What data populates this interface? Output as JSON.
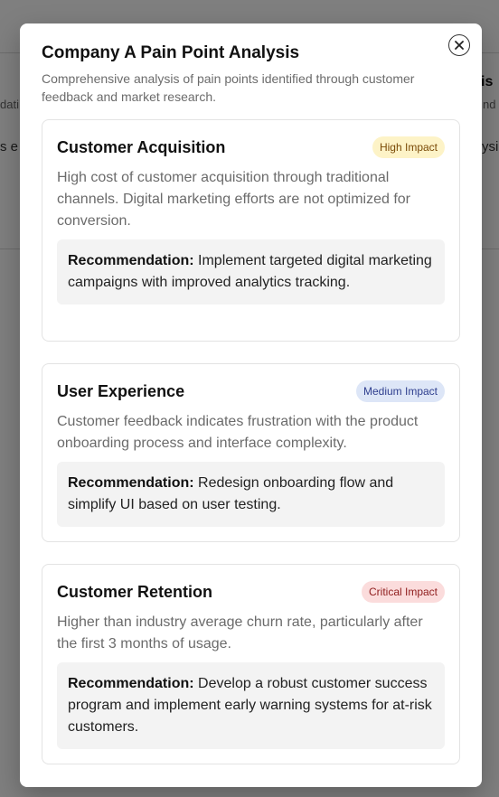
{
  "background": {
    "fragments": [
      "dati",
      "s e",
      "is",
      "nd i",
      "ysi"
    ]
  },
  "modal": {
    "title": "Company A Pain Point Analysis",
    "subtitle": "Comprehensive analysis of pain points identified through customer feedback and market research.",
    "close_icon": "close-icon"
  },
  "pain_points": [
    {
      "title": "Customer Acquisition",
      "impact": "High Impact",
      "impact_color": "#fdf3c7",
      "description": "High cost of customer acquisition through traditional channels. Digital marketing efforts are not optimized for conversion.",
      "recommendation_label": "Recommendation:",
      "recommendation": "Implement targeted digital marketing campaigns with improved analytics tracking."
    },
    {
      "title": "User Experience",
      "impact": "Medium Impact",
      "impact_color": "#dde6f7",
      "description": "Customer feedback indicates frustration with the product onboarding process and interface complexity.",
      "recommendation_label": "Recommendation:",
      "recommendation": "Redesign onboarding flow and simplify UI based on user testing."
    },
    {
      "title": "Customer Retention",
      "impact": "Critical Impact",
      "impact_color": "#fbdcdc",
      "description": "Higher than industry average churn rate, particularly after the first 3 months of usage.",
      "recommendation_label": "Recommendation:",
      "recommendation": "Develop a robust customer success program and implement early warning systems for at-risk customers."
    }
  ]
}
